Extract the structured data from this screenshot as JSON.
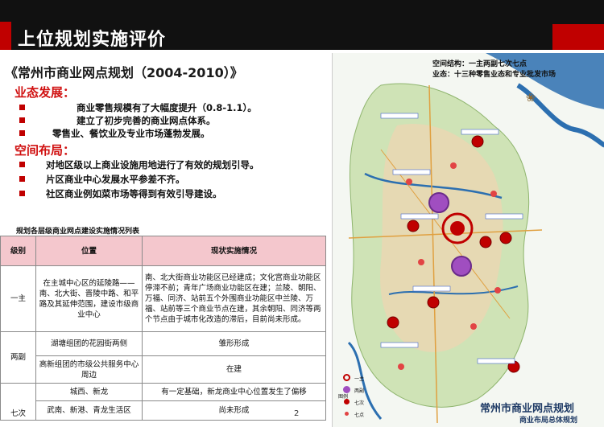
{
  "header": {
    "title": "上位规划实施评价"
  },
  "doc": {
    "main_title": "《常州市商业网点规划（2004-2010）》"
  },
  "sections": [
    {
      "heading": "业态发展：",
      "bullets": [
        "商业零售规模有了大幅度提升（0.8-1.1）。",
        "建立了初步完善的商业网点体系。",
        "零售业、餐饮业及专业市场蓬勃发展。"
      ]
    },
    {
      "heading": "空间布局：",
      "bullets": [
        "对地区级以上商业设施用地进行了有效的规划引导。",
        "片区商业中心发展水平参差不齐。",
        "社区商业例如菜市场等得到有效引导建设。"
      ]
    }
  ],
  "table": {
    "caption": "规划各层级商业网点建设实施情况列表",
    "headers": [
      "级别",
      "位置",
      "现状实施情况"
    ],
    "level_yizhu": "一主",
    "level_liangfu": "两副",
    "level_qici": "七次",
    "yizhu_location": "在主城中心区的延陵路——南、北大街、晋陵中路、和平路及其延伸范围，建设市级商业中心",
    "yizhu_status": "南、北大街商业功能区已经建成；文化宫商业功能区停滞不前；青年广场商业功能区在建；兰陵、朝阳、万福、同济、站前五个外围商业功能区中兰陵、万福、站前等三个商业节点在建，其余朝阳、同济等两个节点由于城市化改造的滞后，目前尚未形成。",
    "fu1_location": "湖塘组团的花园街两侧",
    "fu1_status": "雏形形成",
    "fu2_location": "高新组团的市级公共服务中心周边",
    "fu2_status": "在建",
    "qi1_location": "城西、新龙",
    "qi1_status": "有一定基础，新龙商业中心位置发生了偏移",
    "qi2_location": "武南、新港、青龙生活区",
    "qi2_status": "尚未形成"
  },
  "map": {
    "struct_line": "空间结构：一主两副七次七点",
    "format_line": "业态：十三种零售业态和专业批发市场",
    "plan_title": "常州市商业网点规划",
    "plan_subtitle": "商业布局总体规划",
    "legend_title": "图例",
    "legend_items": [
      "一主",
      "两副",
      "七次",
      "七点"
    ]
  },
  "page": {
    "number": "2"
  },
  "colors": {
    "header_bg": "#111111",
    "accent_red": "#c00000",
    "heading_red": "#d01010",
    "table_header": "#f4c7cd",
    "water": "#2c6fb0",
    "green": "#a9d08e"
  }
}
